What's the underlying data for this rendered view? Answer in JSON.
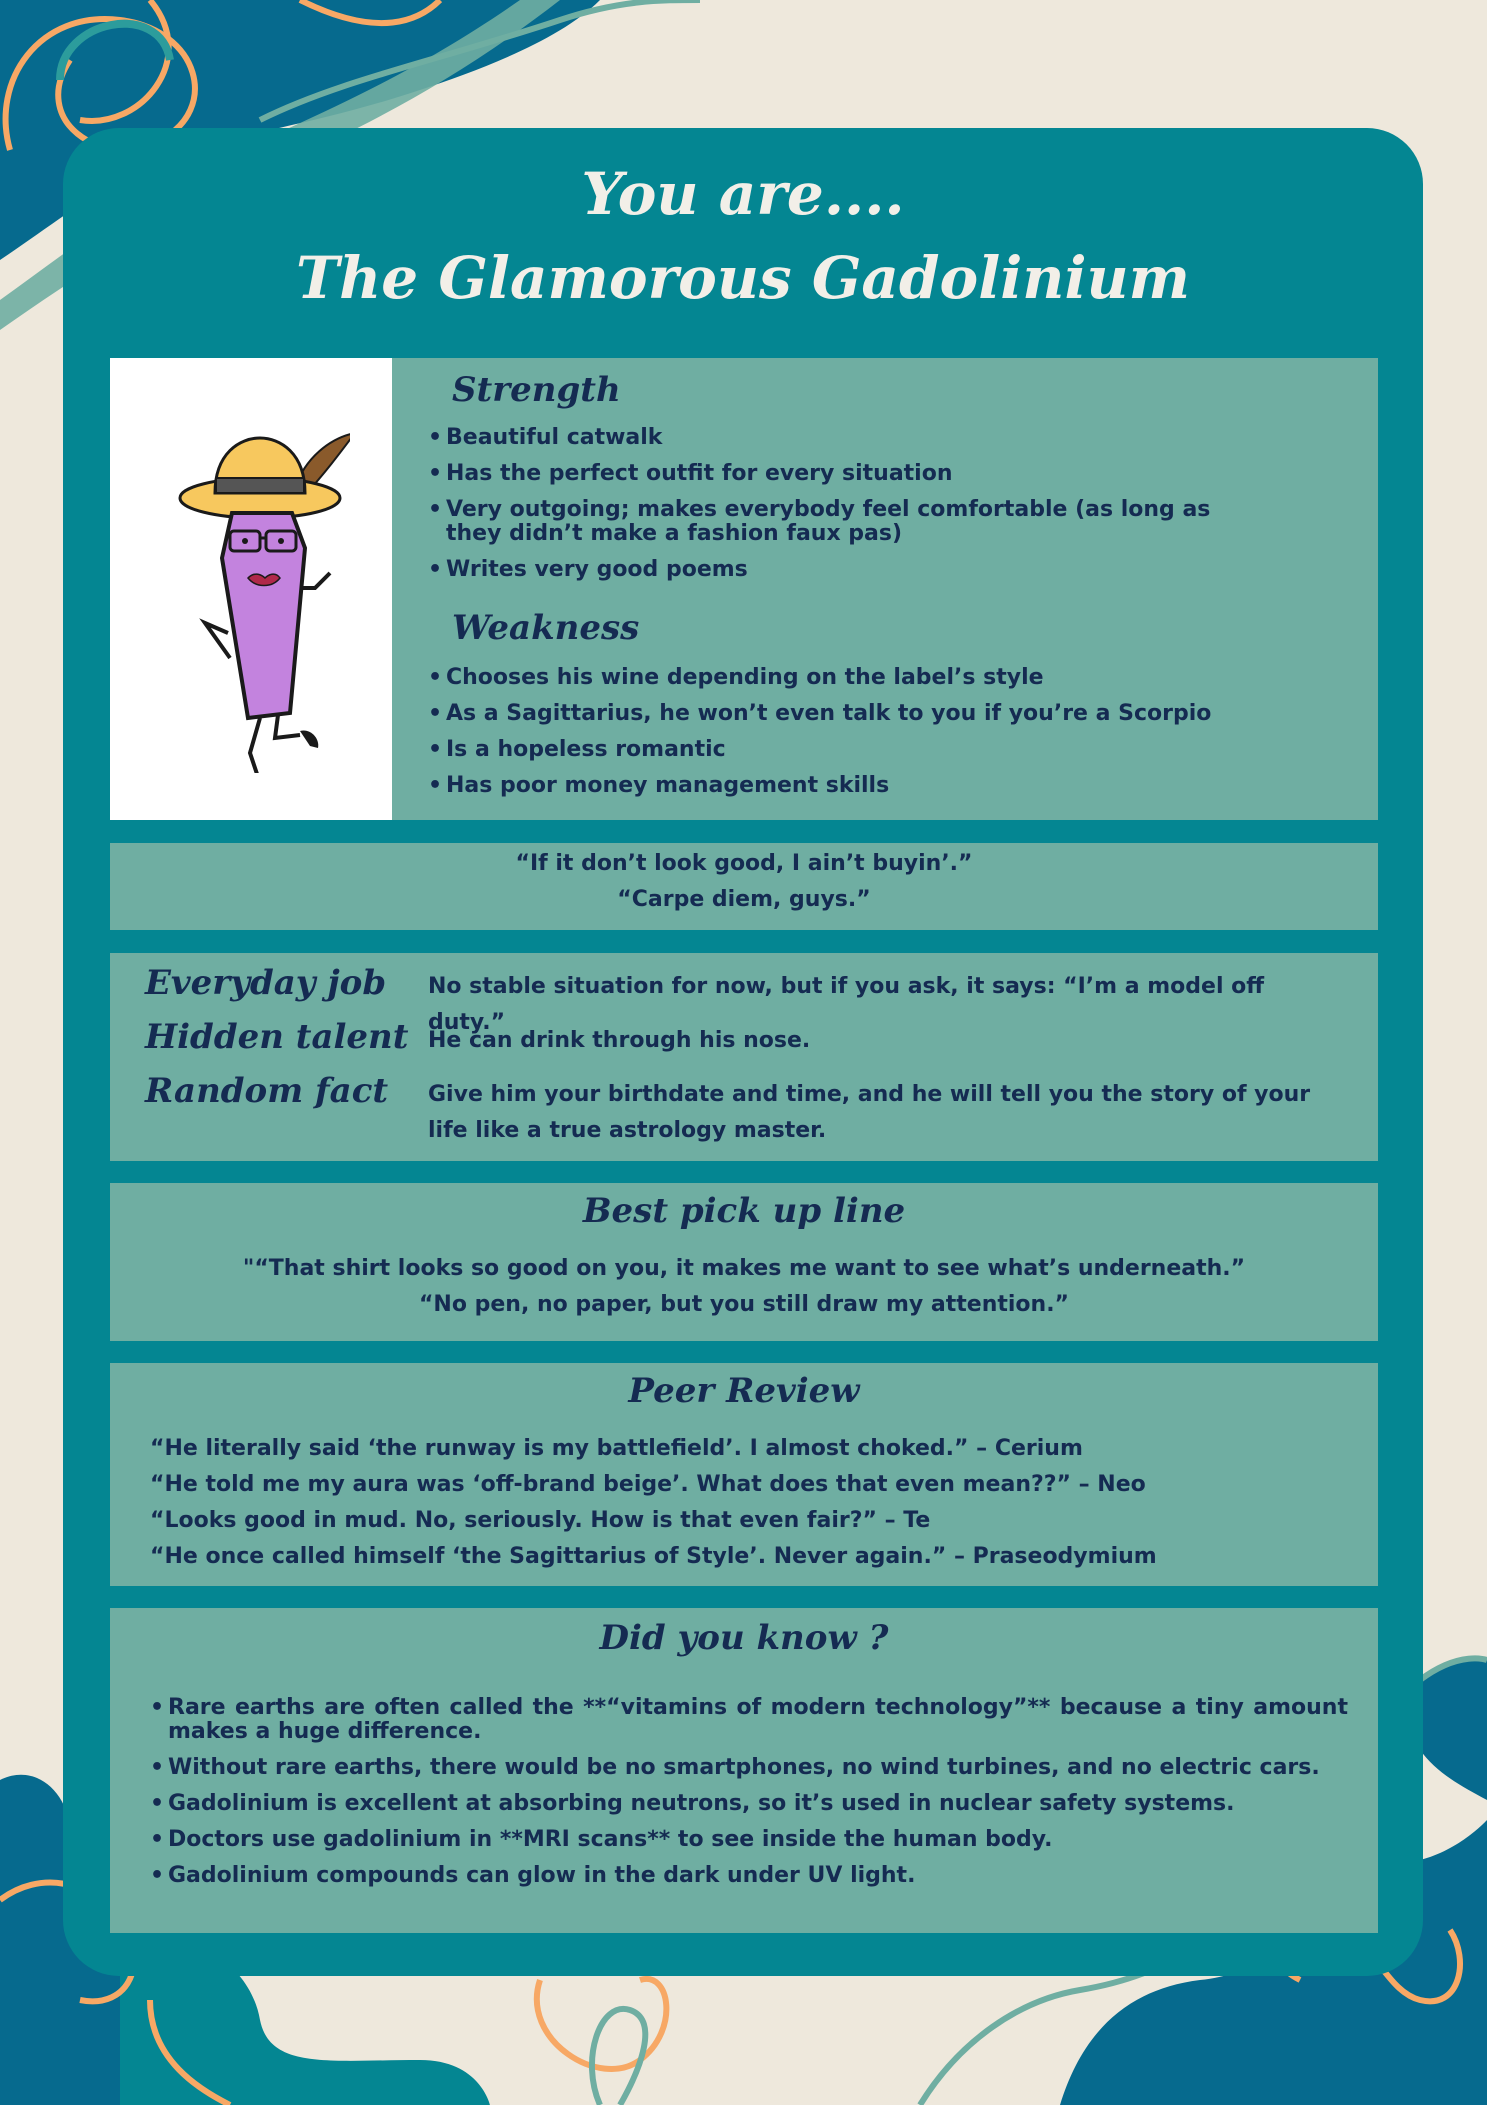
{
  "title": {
    "line1": "You are....",
    "line2": "The Glamorous Gadolinium"
  },
  "avatar": {
    "icon": "gadolinium-character-icon"
  },
  "strength": {
    "heading": "Strength",
    "items": [
      "Beautiful catwalk",
      "Has the perfect outfit for every situation",
      "Very outgoing; makes everybody feel comfortable (as long as they didn’t make a fashion faux pas)",
      "Writes very good poems"
    ]
  },
  "weakness": {
    "heading": "Weakness",
    "items": [
      "Chooses his wine depending on the label’s style",
      "As a Sagittarius, he won’t even talk to you if you’re a Scorpio",
      "Is a hopeless romantic",
      "Has poor money management skills"
    ]
  },
  "quotes": [
    "“If it don’t look good, I ain’t buyin’.”",
    "“Carpe diem, guys.”"
  ],
  "profile": [
    {
      "label": "Everyday job",
      "value": "No stable situation for now, but if you ask, it says: “I’m a model off duty.”"
    },
    {
      "label": "Hidden talent",
      "value": "He can drink through his nose."
    },
    {
      "label": "Random fact",
      "value": "Give him your birthdate and time, and he will tell you the story of your life like a true astrology master."
    }
  ],
  "pickup": {
    "heading": "Best pick up line",
    "lines": [
      "\"“That shirt looks so good on you, it makes me want to see what’s underneath.”",
      "“No pen, no paper, but you still draw my attention.”"
    ]
  },
  "peer_review": {
    "heading": "Peer Review",
    "lines": [
      "“He literally said ‘the runway is my battlefield’. I almost choked.” – Cerium",
      "“He told me my aura was ‘off-brand beige’. What does that even mean??” – Neo",
      "“Looks good in mud. No, seriously. How is that even fair?” – Te",
      "“He once called himself ‘the Sagittarius of Style’. Never again.” – Praseodymium"
    ]
  },
  "did_you_know": {
    "heading": "Did you know ?",
    "items": [
      "Rare earths are often called the **“vitamins of modern technology”** because a tiny amount makes a huge difference.",
      "Without rare earths, there would be no smartphones, no wind turbines, and no electric cars.",
      "Gadolinium is excellent at absorbing neutrons, so it’s used in nuclear safety systems.",
      "Doctors use gadolinium in **MRI scans** to see inside the human body.",
      "Gadolinium compounds can glow in the dark under UV light."
    ]
  },
  "colors": {
    "background": "#EEE8DC",
    "card": "#048692",
    "panel": "#6FAEA2",
    "text": "#152B52",
    "accent_orange": "#F7A865",
    "accent_blue": "#066A8E"
  }
}
